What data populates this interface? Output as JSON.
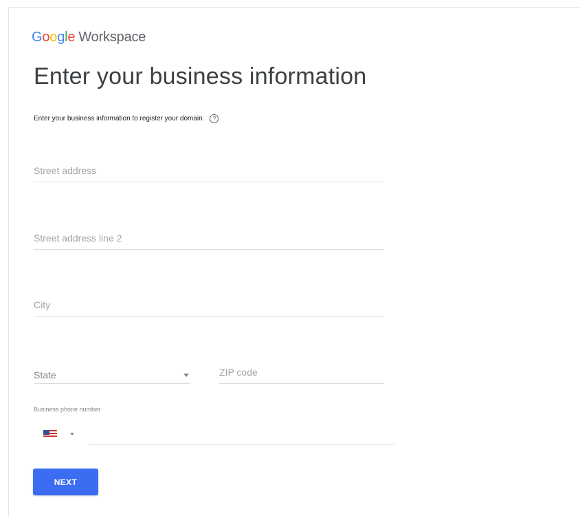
{
  "logo": {
    "google": "Google",
    "product": "Workspace"
  },
  "title": "Enter your business information",
  "subtitle": "Enter your business information to register your domain.",
  "help_icon": "?",
  "fields": {
    "street": {
      "placeholder": "Street address",
      "value": ""
    },
    "street2": {
      "placeholder": "Street address line 2",
      "value": ""
    },
    "city": {
      "placeholder": "City",
      "value": ""
    },
    "state": {
      "label": "State"
    },
    "zip": {
      "placeholder": "ZIP code",
      "value": ""
    },
    "phone": {
      "label": "Business phone number",
      "country_flag": "us-flag-icon",
      "value": ""
    }
  },
  "next_button": "NEXT"
}
